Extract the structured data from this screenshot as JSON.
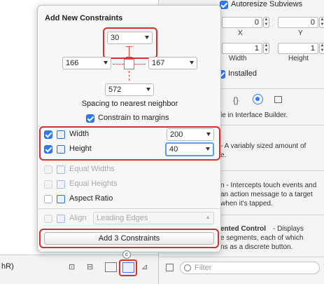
{
  "popover": {
    "title": "Add New Constraints",
    "spacing": {
      "top": "30",
      "left": "166",
      "right": "167",
      "bottom": "572"
    },
    "spacing_label": "Spacing to nearest neighbor",
    "constrain_margins": {
      "label": "Constrain to margins",
      "checked": true
    },
    "width": {
      "label": "Width",
      "value": "200",
      "checked": true
    },
    "height": {
      "label": "Height",
      "value": "40",
      "checked": true
    },
    "equal_widths": {
      "label": "Equal Widths",
      "checked": false,
      "enabled": false
    },
    "equal_heights": {
      "label": "Equal Heights",
      "checked": false,
      "enabled": false
    },
    "aspect_ratio": {
      "label": "Aspect Ratio",
      "checked": false,
      "enabled": true
    },
    "align": {
      "label": "Align",
      "value": "Leading Edges",
      "enabled": false
    },
    "add_button": "Add 3 Constraints",
    "accent_color": "#2f7bf5",
    "highlight_color": "#d9302c"
  },
  "inspector": {
    "autoresize_label": "Autoresize Subviews",
    "autoresize_checked": true,
    "x_value": "0",
    "y_value": "0",
    "x_label": "X",
    "y_label": "Y",
    "width_value": "1",
    "height_value": "1",
    "width_label": "Width",
    "height_label": "Height",
    "installed_label": "Installed",
    "tab_icons": [
      "file-icon",
      "braces-icon",
      "circle-target-icon",
      "grid-icon"
    ],
    "tab_braces": "{}",
    "ib_text": "le in Interface Builder.",
    "lib1_text_a": "- A variably sized amount of",
    "lib1_text_b": "e.",
    "lib2_text_a": "n - Intercepts touch events and",
    "lib2_text_b": "an action message to a target",
    "lib2_text_c": "when it's tapped.",
    "lib3_title": "ented Control",
    "lib3_text_a": " - Displays",
    "lib3_text_b": "e segments, each of which",
    "lib3_text_c": "ns as a discrete button.",
    "filter_placeholder": "Filter"
  },
  "bottom_bar": {
    "left_text": "hR)"
  }
}
